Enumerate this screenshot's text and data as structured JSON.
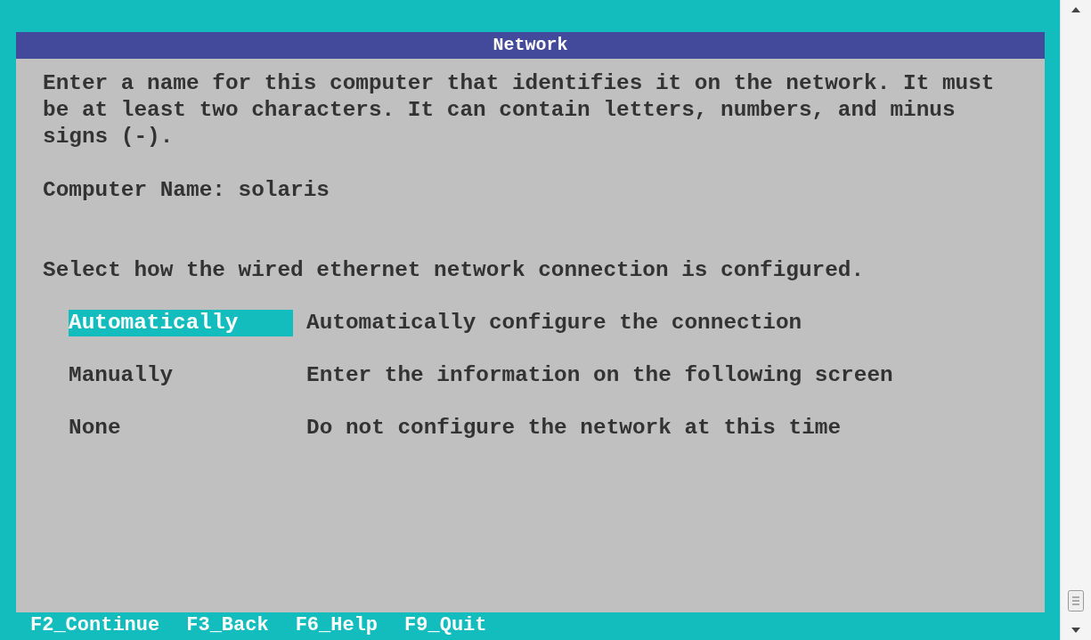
{
  "window": {
    "title": "Network"
  },
  "intro": "Enter a name for this computer that identifies it on the network. It must be at least two characters. It can contain letters, numbers, and minus signs (-).",
  "computer_name": {
    "label": "Computer Name:",
    "value": "solaris"
  },
  "prompt": "Select how the wired ethernet network connection is configured.",
  "options": [
    {
      "label": "Automatically",
      "description": "Automatically configure the connection",
      "selected": true
    },
    {
      "label": "Manually",
      "description": "Enter the information on the following screen",
      "selected": false
    },
    {
      "label": "None",
      "description": "Do not configure the network at this time",
      "selected": false
    }
  ],
  "function_keys": [
    "F2_Continue",
    "F3_Back",
    "F6_Help",
    "F9_Quit"
  ]
}
